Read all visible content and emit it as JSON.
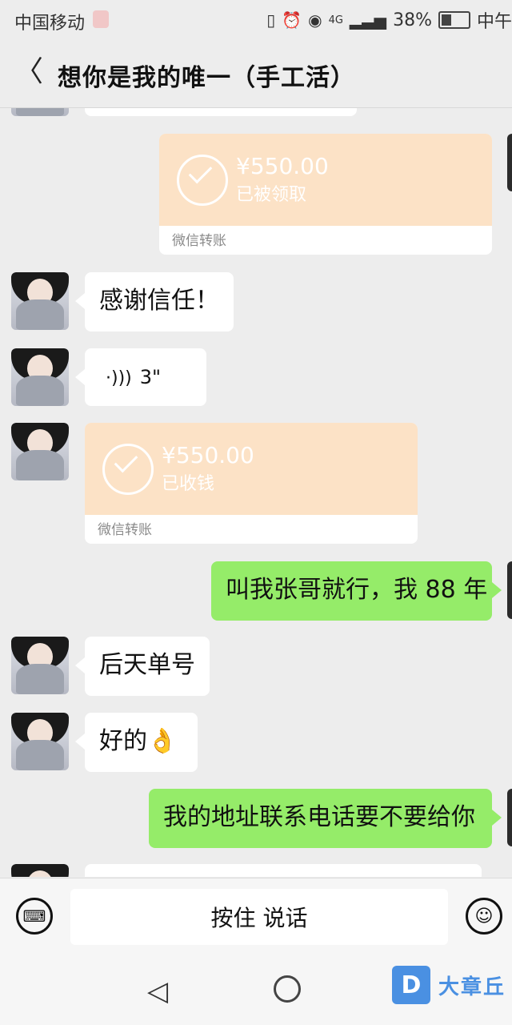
{
  "status_bar": {
    "carrier": "中国移动",
    "battery": "38%",
    "network": "4G",
    "time": "中午"
  },
  "header": {
    "back_icon": "chevron-left-icon",
    "title": "想你是我的唯一（手工活）"
  },
  "messages": [
    {
      "type": "transfer",
      "side": "right",
      "amount": "¥550.00",
      "status": "已被领取",
      "footer": "微信转账"
    },
    {
      "type": "text",
      "side": "left",
      "text": "感谢信任！"
    },
    {
      "type": "voice",
      "side": "left",
      "text": "3\""
    },
    {
      "type": "transfer",
      "side": "left",
      "amount": "¥550.00",
      "status": "已收钱",
      "footer": "微信转账"
    },
    {
      "type": "text",
      "side": "right",
      "text": "叫我张哥就行，我 88 年"
    },
    {
      "type": "text",
      "side": "left",
      "text": "后天单号"
    },
    {
      "type": "text",
      "side": "left",
      "text": "好的👌"
    },
    {
      "type": "text",
      "side": "right",
      "text": "我的地址联系电话要不要给你"
    }
  ],
  "input_bar": {
    "keyboard_icon": "keyboard-icon",
    "talk_label": "按住 说话",
    "emoji_icon": "emoji-icon"
  },
  "nav": {
    "back": "nav-back-icon",
    "home": "nav-home-icon"
  },
  "watermark": {
    "text": "大章丘",
    "logo": "D"
  }
}
